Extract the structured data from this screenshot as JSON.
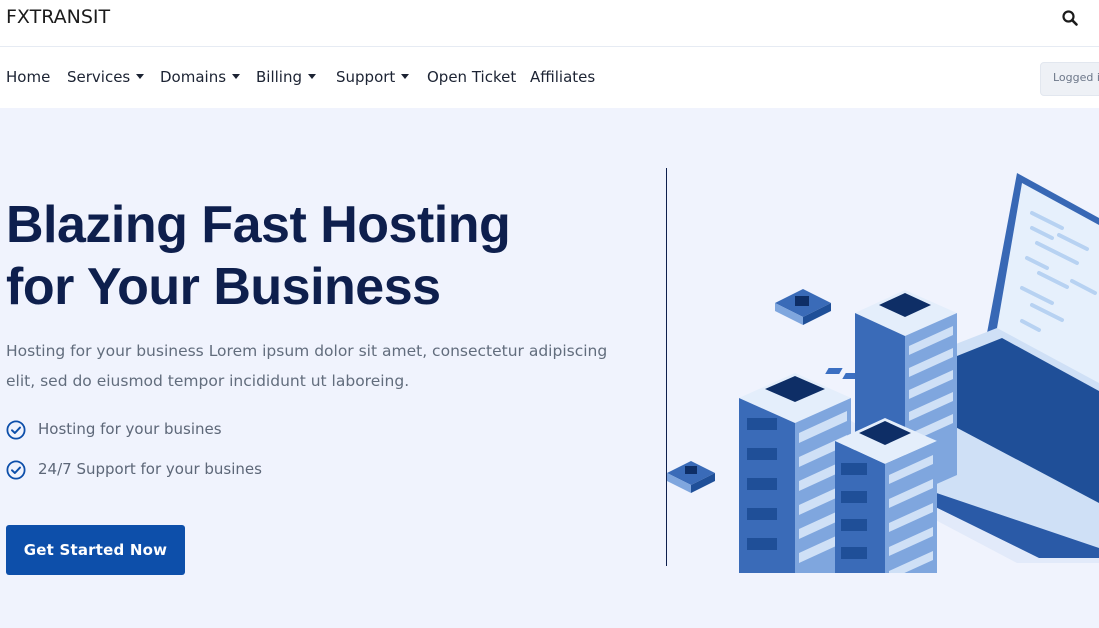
{
  "header": {
    "brand": "FXTRANSIT",
    "search_icon": "search-icon"
  },
  "nav": {
    "items": [
      {
        "label": "Home",
        "dropdown": false
      },
      {
        "label": "Services",
        "dropdown": true
      },
      {
        "label": "Domains",
        "dropdown": true
      },
      {
        "label": "Billing",
        "dropdown": true
      },
      {
        "label": "Support",
        "dropdown": true
      },
      {
        "label": "Open Ticket",
        "dropdown": false
      },
      {
        "label": "Affiliates",
        "dropdown": false
      }
    ],
    "logged_in_text": "Logged i"
  },
  "hero": {
    "title_line1": "Blazing Fast Hosting",
    "title_line2": "for Your Business",
    "description": "Hosting for your business Lorem ipsum dolor sit amet, consectetur adipiscing elit, sed do eiusmod tempor incididunt ut laboreing.",
    "features": [
      {
        "label": "Hosting for your busines",
        "icon": "check-circle-icon"
      },
      {
        "label": "24/7 Support for your busines",
        "icon": "check-circle-icon"
      }
    ],
    "cta_label": "Get Started Now",
    "illustration": "server-racks-and-laptop-illustration"
  },
  "colors": {
    "accent": "#0d4faa",
    "heading": "#0e1f4d",
    "hero_bg": "#f0f3fd"
  }
}
